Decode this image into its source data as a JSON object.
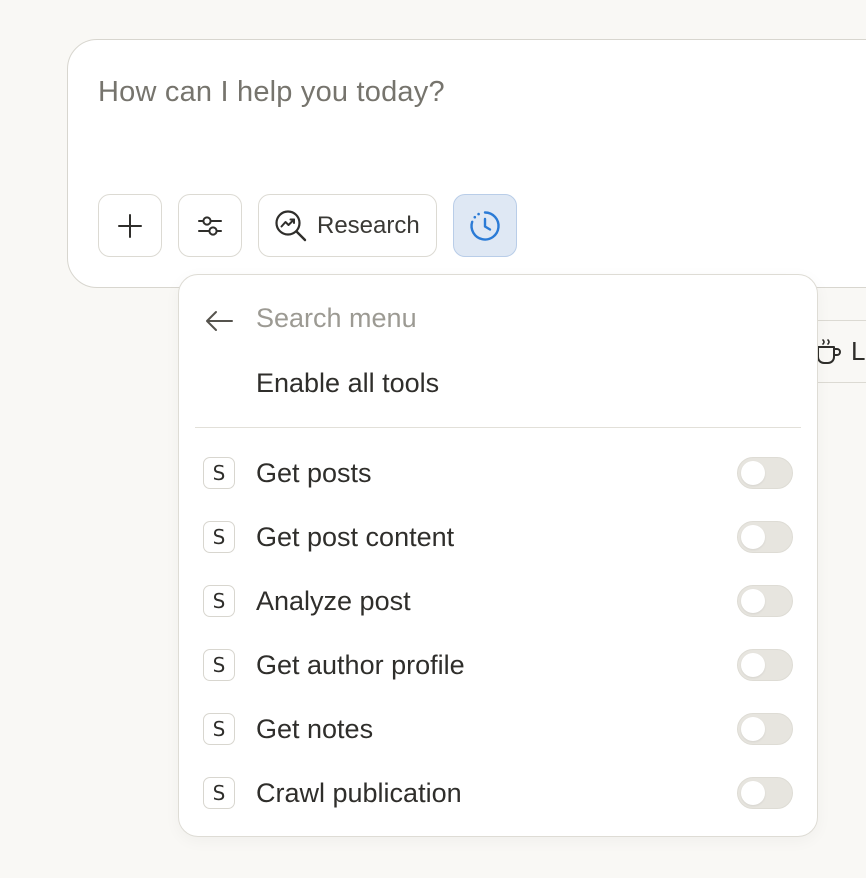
{
  "composer": {
    "placeholder": "How can I help you today?",
    "buttons": {
      "add_icon": "plus-icon",
      "tools_icon": "sliders-icon",
      "research_label": "Research",
      "research_icon": "research-icon",
      "clock_icon": "clock-icon"
    }
  },
  "side_chip": {
    "icon": "coffee-icon",
    "label_visible": "L"
  },
  "menu": {
    "back_icon": "arrow-left-icon",
    "search_placeholder": "Search menu",
    "enable_all": "Enable all tools",
    "tools": [
      {
        "badge": "S",
        "label": "Get posts",
        "enabled": false
      },
      {
        "badge": "S",
        "label": "Get post content",
        "enabled": false
      },
      {
        "badge": "S",
        "label": "Analyze post",
        "enabled": false
      },
      {
        "badge": "S",
        "label": "Get author profile",
        "enabled": false
      },
      {
        "badge": "S",
        "label": "Get notes",
        "enabled": false
      },
      {
        "badge": "S",
        "label": "Crawl publication",
        "enabled": false
      }
    ]
  },
  "colors": {
    "background": "#f9f8f5",
    "accent_blue": "#2b7bd6",
    "active_button_bg": "#dfe8f4"
  }
}
